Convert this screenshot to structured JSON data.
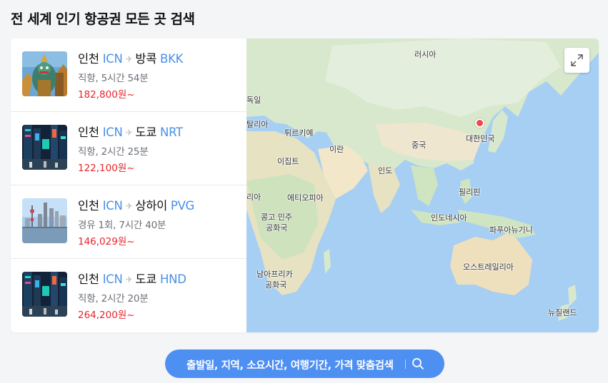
{
  "heading": "전 세계 인기 항공권 모든 곳 검색",
  "routes": [
    {
      "from": "인천",
      "from_code": "ICN",
      "to": "방콕",
      "to_code": "BKK",
      "info": "직항, 5시간 54분",
      "price": "182,800원~",
      "image": "bangkok-temple-guardian"
    },
    {
      "from": "인천",
      "from_code": "ICN",
      "to": "도쿄",
      "to_code": "NRT",
      "info": "직항, 2시간 25분",
      "price": "122,100원~",
      "image": "tokyo-night-street"
    },
    {
      "from": "인천",
      "from_code": "ICN",
      "to": "상하이",
      "to_code": "PVG",
      "info": "경유 1회, 7시간 40분",
      "price": "146,029원~",
      "image": "shanghai-skyline"
    },
    {
      "from": "인천",
      "from_code": "ICN",
      "to": "도쿄",
      "to_code": "HND",
      "info": "직항, 2시간 20분",
      "price": "264,200원~",
      "image": "tokyo-night-street"
    }
  ],
  "map": {
    "labels": {
      "russia": "러시아",
      "germany": "독일",
      "italy": "탈리아",
      "turkey": "튀르키예",
      "korea": "대한민국",
      "iran": "이란",
      "china": "중국",
      "egypt": "이집트",
      "india": "인도",
      "ethiopia": "에티오피아",
      "philippines": "필리핀",
      "somalia": "리아",
      "congo_1": "콩고 민주",
      "congo_2": "공화국",
      "indonesia": "인도네시아",
      "png": "파푸아뉴기니",
      "south_africa_1": "남아프리카",
      "south_africa_2": "공화국",
      "australia": "오스트레일리아",
      "new_zealand": "뉴질랜드"
    },
    "pin_color": "#ec4a4a",
    "expand_icon": "expand-icon"
  },
  "search_button": {
    "label": "출발일, 지역, 소요시간, 여행기간, 가격 맞춤검색",
    "icon": "search-icon"
  },
  "colors": {
    "accent": "#4e8ff2",
    "code": "#4a8fe8",
    "price": "#e8232b",
    "ocean": "#a6cff3"
  }
}
